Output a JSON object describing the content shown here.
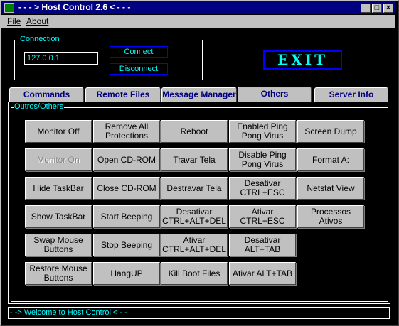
{
  "window": {
    "title": "- - - > Host Control 2.6 < - - -"
  },
  "menu": {
    "file": "File",
    "about": "About"
  },
  "connection": {
    "group_label": "Connection",
    "ip_value": "127.0.0.1",
    "connect_label": "Connect",
    "disconnect_label": "Disconnect"
  },
  "exit_label": "EXIT",
  "tabs": [
    {
      "label": "Commands"
    },
    {
      "label": "Remote Files"
    },
    {
      "label": "Message Manager"
    },
    {
      "label": "Others"
    },
    {
      "label": "Server Info"
    }
  ],
  "others": {
    "group_label": "Outros/Others",
    "buttons": [
      {
        "label": "Monitor Off"
      },
      {
        "label": "Monitor On"
      },
      {
        "label": "Hide TaskBar"
      },
      {
        "label": "Show TaskBar"
      },
      {
        "label": "Swap Mouse Buttons"
      },
      {
        "label": "Restore Mouse Buttons"
      },
      {
        "label": "Remove All Protections"
      },
      {
        "label": "Open CD-ROM"
      },
      {
        "label": "Close CD-ROM"
      },
      {
        "label": "Start Beeping"
      },
      {
        "label": "Stop Beeping"
      },
      {
        "label": "HangUP"
      },
      {
        "label": "Reboot"
      },
      {
        "label": "Travar Tela"
      },
      {
        "label": "Destravar Tela"
      },
      {
        "label": "Desativar CTRL+ALT+DEL"
      },
      {
        "label": "Ativar CTRL+ALT+DEL"
      },
      {
        "label": "Kill Boot Files"
      },
      {
        "label": "Enabled Ping Pong Virus"
      },
      {
        "label": "Disable Ping Pong Virus"
      },
      {
        "label": "Desativar CTRL+ESC"
      },
      {
        "label": "Ativar CTRL+ESC"
      },
      {
        "label": "Desativar ALT+TAB"
      },
      {
        "label": "Ativar ALT+TAB"
      },
      {
        "label": "Screen Dump"
      },
      {
        "label": "Format A:"
      },
      {
        "label": "Netstat View"
      },
      {
        "label": "Processos Ativos"
      }
    ]
  },
  "status": {
    "text": "- -> Welcome to Host Control < - -"
  }
}
